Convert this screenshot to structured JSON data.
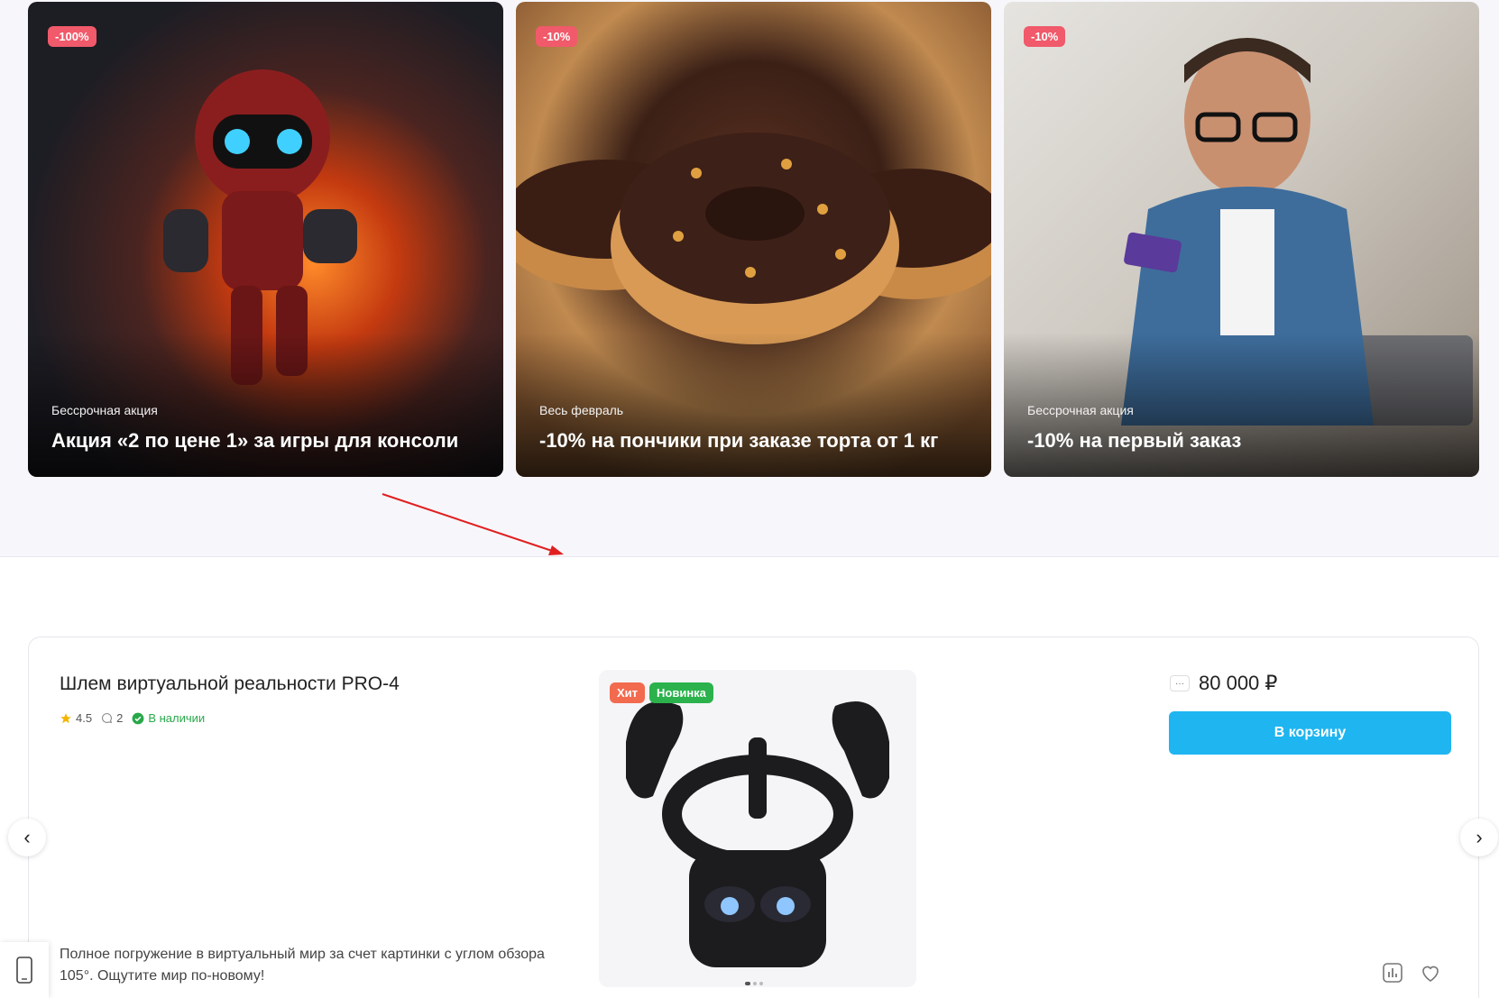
{
  "promos": [
    {
      "badge": "-100%",
      "subtitle": "Бессрочная акция",
      "title": "Акция «2 по цене 1» за игры для консоли"
    },
    {
      "badge": "-10%",
      "subtitle": "Весь февраль",
      "title": "-10% на пончики при заказе торта от 1 кг"
    },
    {
      "badge": "-10%",
      "subtitle": "Бессрочная акция",
      "title": "-10% на первый заказ"
    }
  ],
  "product": {
    "name": "Шлем виртуальной реальности PRO-4",
    "rating": "4.5",
    "reviews": "2",
    "stock": "В наличии",
    "description": "Полное погружение в виртуальный мир за счет картинки с углом обзора 105°. Ощутите мир по-новому!",
    "tags": {
      "hit": "Хит",
      "new": "Новинка"
    },
    "price": "80 000 ₽",
    "more": "···",
    "cart_label": "В корзину"
  },
  "nav": {
    "prev": "‹",
    "next": "›"
  },
  "colors": {
    "accent": "#1fb5f0",
    "badge": "#f05a6a",
    "stock": "#29a84a",
    "hit": "#f26b4f",
    "new": "#2bb24c"
  },
  "icons": [
    "star-icon",
    "comment-icon",
    "check-circle-icon",
    "compare-icon",
    "heart-icon",
    "phone-icon",
    "vr-headset-image"
  ]
}
